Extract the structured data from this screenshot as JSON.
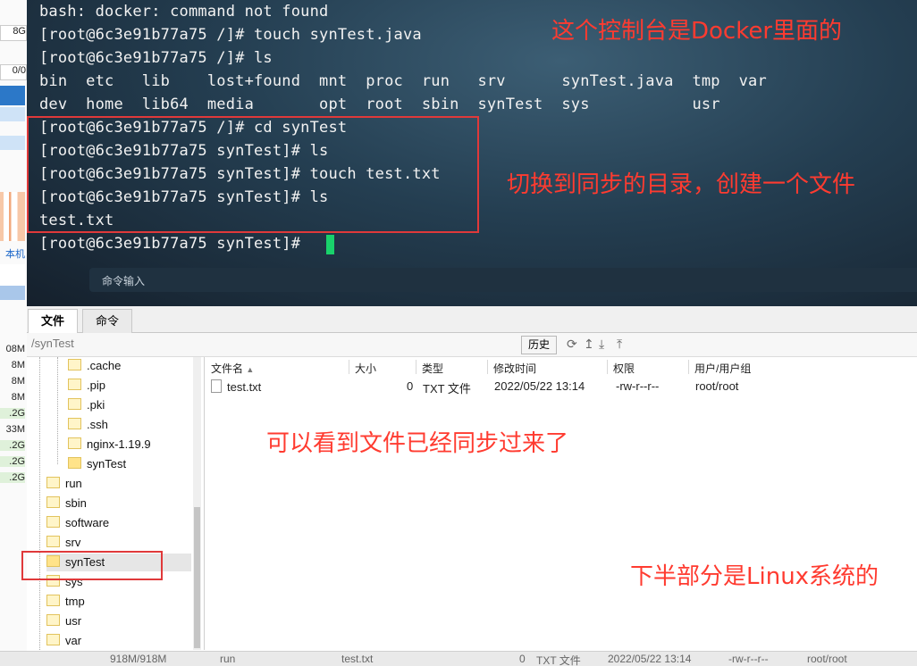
{
  "left_strip": {
    "cells": [
      "8G",
      "0/0",
      "本机",
      "08M",
      "8M",
      "8M",
      "8M",
      ".2G",
      "33M",
      ".2G",
      ".2G",
      ".2G"
    ]
  },
  "terminal": {
    "lines": [
      "bash: docker: command not found",
      "[root@6c3e91b77a75 /]# touch synTest.java",
      "[root@6c3e91b77a75 /]# ls",
      "bin  etc   lib    lost+found  mnt  proc  run   srv      synTest.java  tmp  var",
      "dev  home  lib64  media       opt  root  sbin  synTest  sys           usr",
      "[root@6c3e91b77a75 /]# cd synTest",
      "[root@6c3e91b77a75 synTest]# ls",
      "[root@6c3e91b77a75 synTest]# touch test.txt",
      "[root@6c3e91b77a75 synTest]# ls",
      "test.txt",
      "[root@6c3e91b77a75 synTest]# "
    ],
    "command_bar_placeholder": "命令输入"
  },
  "annotations": {
    "terminal_note": "这个控制台是Docker里面的",
    "switch_note": "切换到同步的目录，创建一个文件",
    "sync_note": "可以看到文件已经同步过来了",
    "linux_note": "下半部分是Linux系统的"
  },
  "tabs": [
    {
      "label": "文件",
      "active": true
    },
    {
      "label": "命令",
      "active": false
    }
  ],
  "path": {
    "value": "/synTest",
    "history_label": "历史"
  },
  "tree": {
    "items": [
      {
        "label": ".cache",
        "open": false
      },
      {
        "label": ".pip",
        "open": false
      },
      {
        "label": ".pki",
        "open": false
      },
      {
        "label": ".ssh",
        "open": false
      },
      {
        "label": "nginx-1.19.9",
        "open": false
      },
      {
        "label": "synTest",
        "open": true
      },
      {
        "label": "run",
        "open": false
      },
      {
        "label": "sbin",
        "open": false
      },
      {
        "label": "software",
        "open": false
      },
      {
        "label": "srv",
        "open": false
      },
      {
        "label": "synTest",
        "open": false,
        "selected": true
      },
      {
        "label": "sys",
        "open": false
      },
      {
        "label": "tmp",
        "open": false
      },
      {
        "label": "usr",
        "open": false
      },
      {
        "label": "var",
        "open": false
      }
    ]
  },
  "file_table": {
    "columns": [
      "文件名",
      "大小",
      "类型",
      "修改时间",
      "权限",
      "用户/用户组"
    ],
    "rows": [
      {
        "name": "test.txt",
        "size": "0",
        "type": "TXT 文件",
        "modified": "2022/05/22 13:14",
        "perms": "-rw-r--r--",
        "owner": "root/root"
      }
    ]
  },
  "bottom_strip": {
    "texts": [
      "918M/918M",
      "run",
      "test.txt",
      "0",
      "TXT 文件",
      "2022/05/22 13:14",
      "-rw-r--r--",
      "root/root"
    ]
  }
}
